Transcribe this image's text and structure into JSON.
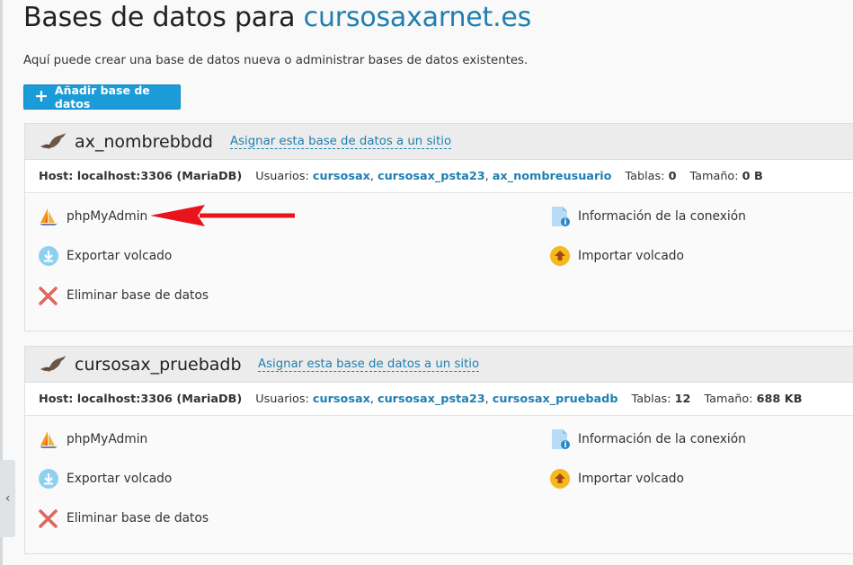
{
  "page": {
    "title_prefix": "Bases de datos para",
    "title_domain": "cursosaxarnet.es",
    "description": "Aquí puede crear una base de datos nueva o administrar bases de datos existentes.",
    "add_button_label": "Añadir base de datos"
  },
  "sidebar_toggle": "‹",
  "databases": [
    {
      "name": "ax_nombrebbdd",
      "assign_label": "Asignar esta base de datos a un sitio",
      "host_label": "Host: localhost:3306 (MariaDB)",
      "users_label": "Usuarios:",
      "users": [
        "cursosax",
        "cursosax_psta23",
        "ax_nombreusuario"
      ],
      "tables_label": "Tablas:",
      "tables": "0",
      "size_label": "Tamaño:",
      "size": "0 B",
      "actions": {
        "phpmyadmin": "phpMyAdmin",
        "export": "Exportar volcado",
        "delete": "Eliminar base de datos",
        "connection_info": "Información de la conexión",
        "import": "Importar volcado"
      }
    },
    {
      "name": "cursosax_pruebadb",
      "assign_label": "Asignar esta base de datos a un sitio",
      "host_label": "Host: localhost:3306 (MariaDB)",
      "users_label": "Usuarios:",
      "users": [
        "cursosax",
        "cursosax_psta23",
        "cursosax_pruebadb"
      ],
      "tables_label": "Tablas:",
      "tables": "12",
      "size_label": "Tamaño:",
      "size": "688 KB",
      "actions": {
        "phpmyadmin": "phpMyAdmin",
        "export": "Exportar volcado",
        "delete": "Eliminar base de datos",
        "connection_info": "Información de la conexión",
        "import": "Importar volcado"
      }
    }
  ],
  "colors": {
    "accent": "#1b9cd8",
    "link": "#1f7fb1",
    "annotation_arrow": "#e8141c"
  }
}
